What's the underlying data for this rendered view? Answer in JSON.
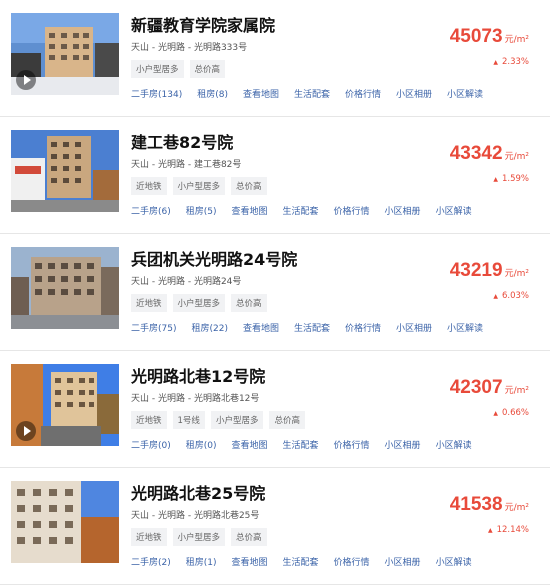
{
  "colors": {
    "price": "#e84a3a",
    "link": "#3b63a8",
    "tag_bg": "#f1f2f4"
  },
  "items": [
    {
      "title": "新疆教育学院家属院",
      "address": "天山 - 光明路 - 光明路333号",
      "tags": [
        "小户型居多",
        "总价高"
      ],
      "price": "45073",
      "unit": "元/m²",
      "change": "2.33%",
      "has_video": true,
      "links": [
        "二手房(134)",
        "租房(8)",
        "查看地图",
        "生活配套",
        "价格行情",
        "小区相册",
        "小区解读"
      ]
    },
    {
      "title": "建工巷82号院",
      "address": "天山 - 光明路 - 建工巷82号",
      "tags": [
        "近地铁",
        "小户型居多",
        "总价高"
      ],
      "price": "43342",
      "unit": "元/m²",
      "change": "1.59%",
      "has_video": false,
      "links": [
        "二手房(6)",
        "租房(5)",
        "查看地图",
        "生活配套",
        "价格行情",
        "小区相册",
        "小区解读"
      ]
    },
    {
      "title": "兵团机关光明路24号院",
      "address": "天山 - 光明路 - 光明路24号",
      "tags": [
        "近地铁",
        "小户型居多",
        "总价高"
      ],
      "price": "43219",
      "unit": "元/m²",
      "change": "6.03%",
      "has_video": false,
      "links": [
        "二手房(75)",
        "租房(22)",
        "查看地图",
        "生活配套",
        "价格行情",
        "小区相册",
        "小区解读"
      ]
    },
    {
      "title": "光明路北巷12号院",
      "address": "天山 - 光明路 - 光明路北巷12号",
      "tags": [
        "近地铁",
        "1号线",
        "小户型居多",
        "总价高"
      ],
      "price": "42307",
      "unit": "元/m²",
      "change": "0.66%",
      "has_video": true,
      "links": [
        "二手房(0)",
        "租房(0)",
        "查看地图",
        "生活配套",
        "价格行情",
        "小区相册",
        "小区解读"
      ]
    },
    {
      "title": "光明路北巷25号院",
      "address": "天山 - 光明路 - 光明路北巷25号",
      "tags": [
        "近地铁",
        "小户型居多",
        "总价高"
      ],
      "price": "41538",
      "unit": "元/m²",
      "change": "12.14%",
      "has_video": false,
      "links": [
        "二手房(2)",
        "租房(1)",
        "查看地图",
        "生活配套",
        "价格行情",
        "小区相册",
        "小区解读"
      ]
    }
  ]
}
